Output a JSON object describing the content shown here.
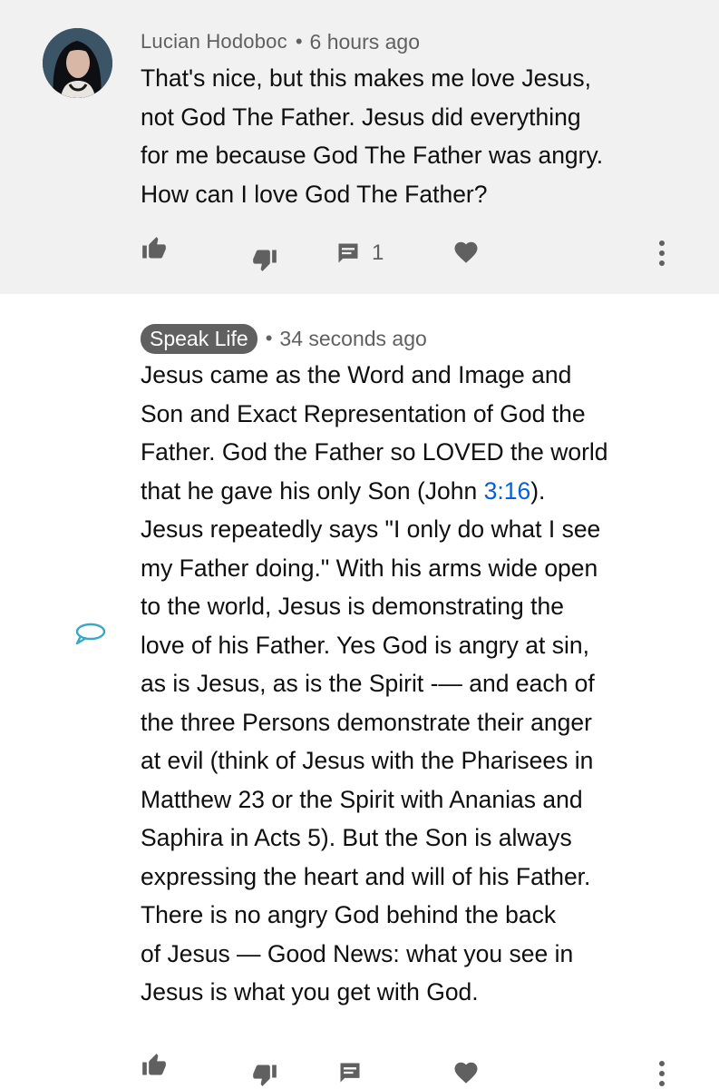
{
  "comments": [
    {
      "author": "Lucian Hodoboc",
      "separator": "•",
      "time": "6 hours ago",
      "text": "That's nice, but this makes me love Jesus,\nnot God The Father. Jesus did everything\nfor me because God The Father was angry.\nHow can I love God The Father?",
      "reply_count": "1",
      "icons": [
        "like-icon",
        "dislike-icon",
        "reply-icon",
        "heart-icon",
        "more-vertical-icon"
      ]
    },
    {
      "author": "Speak Life",
      "separator": "•",
      "time": "34 seconds ago",
      "text_before_link": "Jesus came as the Word and Image and\nSon and Exact Representation of God the\nFather. God the Father so LOVED the world\nthat he gave his only Son (John ",
      "link": "3:16",
      "text_after_link": ").\nJesus repeatedly says \"I only do what I see\nmy Father doing.\" With his arms wide open\nto the world, Jesus is demonstrating the\nlove of his Father. Yes God is angry at sin,\nas is Jesus, as is the Spirit -— and each of\nthe three Persons demonstrate their anger\nat evil (think of Jesus with the Pharisees in\nMatthew 23 or the Spirit with Ananias and\nSaphira in Acts 5). But the Son is always\nexpressing the heart and will of his Father.\nThere is no angry God behind the back\nof Jesus —  Good News: what you see in\nJesus is what you get with God.",
      "icons": [
        "like-icon",
        "dislike-icon",
        "reply-icon",
        "heart-icon",
        "more-vertical-icon"
      ]
    }
  ],
  "colors": {
    "first_comment_bg": "#f1f1f1",
    "secondary_text": "#606060",
    "link": "#065fd4",
    "icon": "#606060",
    "channel_icon": "#3aa6c8"
  }
}
